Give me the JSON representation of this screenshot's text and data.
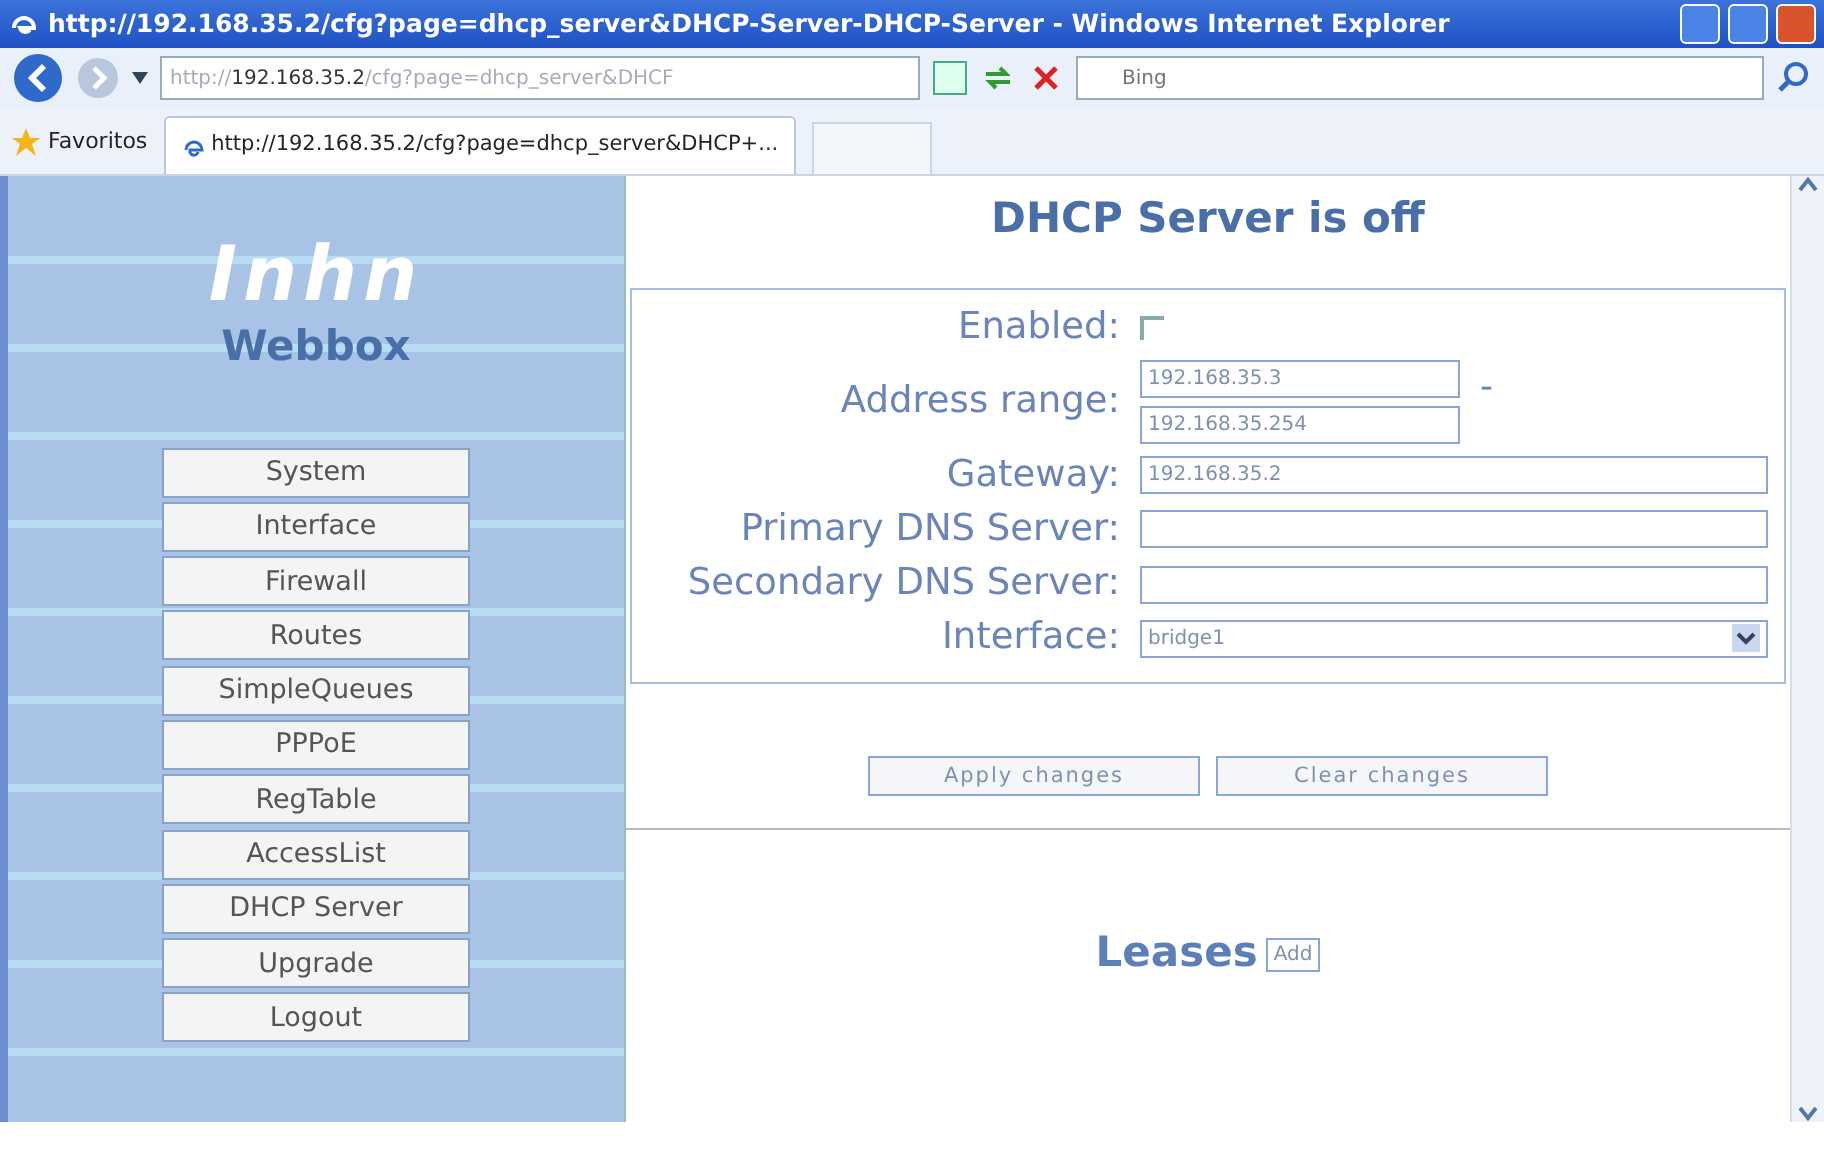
{
  "window": {
    "title": "http://192.168.35.2/cfg?page=dhcp_server&DHCP-Server-DHCP-Server - Windows Internet Explorer"
  },
  "address_bar": {
    "url_prefix": "http://",
    "url_host": "192.168.35.2",
    "url_rest": "/cfg?page=dhcp_server&DHCF"
  },
  "search": {
    "placeholder": "Bing"
  },
  "favorites": {
    "label": "Favoritos"
  },
  "tabs": [
    {
      "label": "http://192.168.35.2/cfg?page=dhcp_server&DHCP+...",
      "selected": true
    }
  ],
  "sidebar": {
    "logo": "Inhn",
    "brand": "Webbox",
    "items": [
      {
        "label": "System"
      },
      {
        "label": "Interface"
      },
      {
        "label": "Firewall"
      },
      {
        "label": "Routes"
      },
      {
        "label": "SimpleQueues"
      },
      {
        "label": "PPPoE"
      },
      {
        "label": "RegTable"
      },
      {
        "label": "AccessList"
      },
      {
        "label": "DHCP Server"
      },
      {
        "label": "Upgrade"
      },
      {
        "label": "Logout"
      }
    ]
  },
  "heading": "DHCP Server is off",
  "form": {
    "enabled": {
      "label": "Enabled:",
      "checked": false
    },
    "address_range": {
      "label": "Address range:",
      "separator": "-",
      "start": "192.168.35.3",
      "end": "192.168.35.254"
    },
    "fields": [
      {
        "label": "Gateway:",
        "value": "192.168.35.2"
      },
      {
        "label": "Primary DNS Server:"
      },
      {
        "label": "Secondary DNS Server:"
      }
    ],
    "interface": {
      "label": "Interface:",
      "value": "bridge1"
    }
  },
  "buttons": [
    "Apply changes",
    "Clear changes"
  ],
  "leases": {
    "title": "Leases",
    "add": "Add"
  }
}
